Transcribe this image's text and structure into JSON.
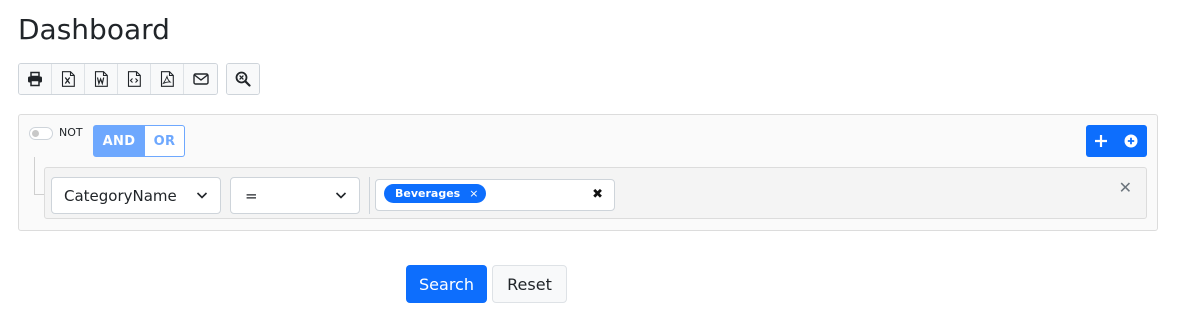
{
  "page": {
    "title": "Dashboard"
  },
  "toolbar": {
    "export_buttons": [
      {
        "icon": "printer-icon"
      },
      {
        "icon": "excel-file-icon"
      },
      {
        "icon": "word-file-icon"
      },
      {
        "icon": "html-file-icon"
      },
      {
        "icon": "pdf-file-icon"
      },
      {
        "icon": "envelope-icon"
      }
    ],
    "search_button": {
      "icon": "zoom-search-icon"
    }
  },
  "query_builder": {
    "not_label": "NOT",
    "not_enabled": false,
    "conditions": {
      "and_label": "AND",
      "or_label": "OR",
      "selected": "AND"
    },
    "add_rule_icon": "plus-icon",
    "add_group_icon": "plus-circle-icon",
    "rule": {
      "field": "CategoryName",
      "operator": "=",
      "values": [
        "Beverages"
      ],
      "chip_remove": "×",
      "clear": "✖",
      "delete": "✕"
    }
  },
  "actions": {
    "search_label": "Search",
    "reset_label": "Reset"
  },
  "colors": {
    "primary": "#0d6efd",
    "primary_light": "#6ea8fe",
    "panel_bg": "#fafafa"
  }
}
